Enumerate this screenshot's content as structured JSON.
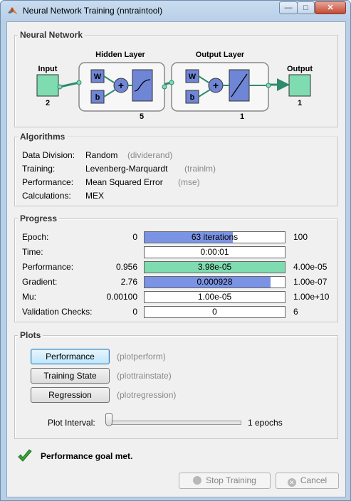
{
  "window": {
    "title": "Neural Network Training (nntraintool)",
    "icon": "matlab-icon",
    "controls": {
      "minimize": "—",
      "maximize": "□",
      "close": "✕"
    }
  },
  "network": {
    "section_title": "Neural Network",
    "input_label": "Input",
    "input_size": "2",
    "hidden_title": "Hidden Layer",
    "hidden_size": "5",
    "output_title": "Output Layer",
    "output_size": "1",
    "output_label": "Output",
    "final_size": "1",
    "weight_label": "W",
    "bias_label": "b",
    "plus_label": "+",
    "colors": {
      "node": "#7fdcb1",
      "block": "#6f86d6",
      "layer_box": "#f7f7f7"
    }
  },
  "algorithms": {
    "section_title": "Algorithms",
    "rows": [
      {
        "label": "Data Division:",
        "value": "Random",
        "func": "(dividerand)"
      },
      {
        "label": "Training:",
        "value": "Levenberg-Marquardt",
        "func": "(trainlm)"
      },
      {
        "label": "Performance:",
        "value": "Mean Squared Error",
        "func": "(mse)"
      },
      {
        "label": "Calculations:",
        "value": "MEX",
        "func": ""
      }
    ]
  },
  "progress": {
    "section_title": "Progress",
    "rows": [
      {
        "label": "Epoch:",
        "start": "0",
        "bar_text": "63 iterations",
        "end": "100",
        "fill": 0.63,
        "color": "#7b93e4"
      },
      {
        "label": "Time:",
        "start": "",
        "bar_text": "0:00:01",
        "end": "",
        "fill": 0,
        "color": "#7b93e4"
      },
      {
        "label": "Performance:",
        "start": "0.956",
        "bar_text": "3.98e-05",
        "end": "4.00e-05",
        "fill": 1.0,
        "color": "#7fdcb1"
      },
      {
        "label": "Gradient:",
        "start": "2.76",
        "bar_text": "0.000928",
        "end": "1.00e-07",
        "fill": 0.9,
        "color": "#7b93e4"
      },
      {
        "label": "Mu:",
        "start": "0.00100",
        "bar_text": "1.00e-05",
        "end": "1.00e+10",
        "fill": 0,
        "color": "#7b93e4"
      },
      {
        "label": "Validation Checks:",
        "start": "0",
        "bar_text": "0",
        "end": "6",
        "fill": 0,
        "color": "#7b93e4"
      }
    ]
  },
  "plots": {
    "section_title": "Plots",
    "buttons": [
      {
        "label": "Performance",
        "func": "(plotperform)"
      },
      {
        "label": "Training State",
        "func": "(plottrainstate)"
      },
      {
        "label": "Regression",
        "func": "(plotregression)"
      }
    ],
    "interval_label": "Plot Interval:",
    "interval_value": "1 epochs",
    "slider_level": 0
  },
  "status": {
    "message": "Performance goal met.",
    "icon": "checkmark-icon"
  },
  "footer": {
    "stop_label": "Stop Training",
    "cancel_label": "Cancel"
  }
}
